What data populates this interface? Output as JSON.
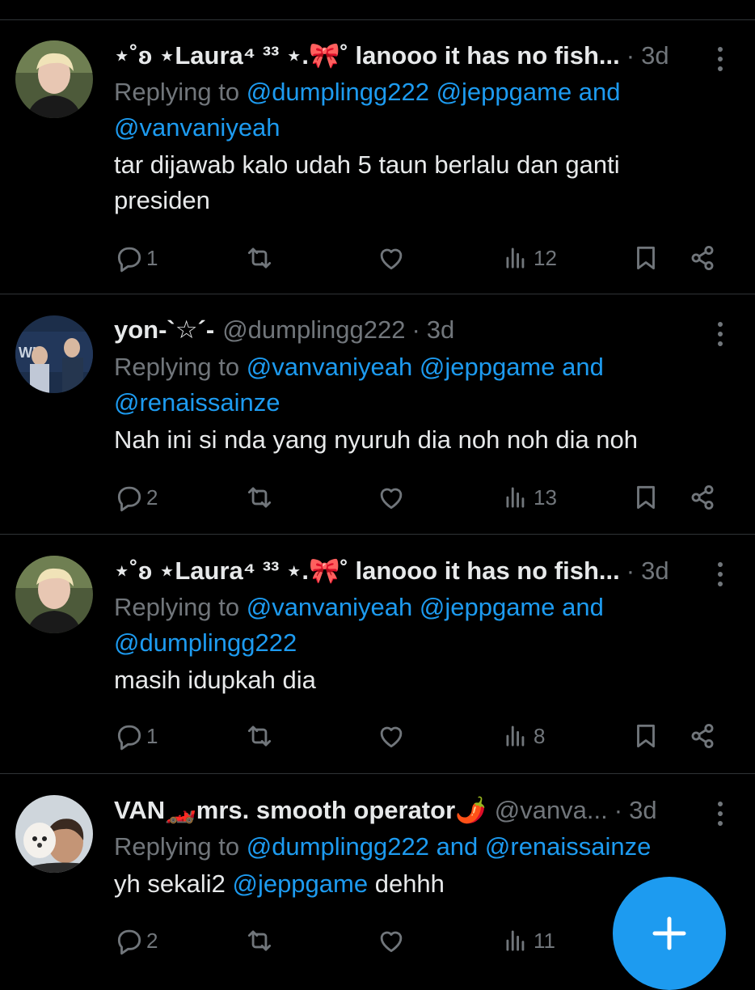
{
  "tweets": [
    {
      "name": "⋆˚ʚ ⋆Laura⁴ ³³ ⋆.🎀˚ lanooo it has no fish...",
      "handle": "",
      "time": "3d",
      "reply_prefix": "Replying to ",
      "reply_line1": "@dumplingg222 @jeppgame and",
      "reply_line2": "@vanvaniyeah",
      "text": "tar dijawab kalo udah 5 taun berlalu dan ganti presiden",
      "replies": "1",
      "views": "12"
    },
    {
      "name": "yon-`☆´-",
      "handle": "@dumplingg222",
      "time": "3d",
      "reply_prefix": "Replying to ",
      "reply_line1": "@vanvaniyeah @jeppgame and",
      "reply_line2": "@renaissainze",
      "text": "Nah ini si nda yang nyuruh dia noh noh dia noh",
      "replies": "2",
      "views": "13"
    },
    {
      "name": "⋆˚ʚ ⋆Laura⁴ ³³ ⋆.🎀˚ lanooo it has no fish...",
      "handle": "",
      "time": "3d",
      "reply_prefix": "Replying to ",
      "reply_line1": "@vanvaniyeah @jeppgame and",
      "reply_line2": "@dumplingg222",
      "text": "masih idupkah dia",
      "replies": "1",
      "views": "8"
    },
    {
      "name": "VAN🏎️mrs. smooth operator🌶️",
      "handle": "@vanva...",
      "time": "3d",
      "reply_prefix": "Replying to ",
      "reply_line1": "@dumplingg222 and @renaissainze",
      "text_before": "yh sekali2 ",
      "text_mention": "@jeppgame",
      "text_after": " dehhh",
      "replies": "2",
      "views": "11"
    }
  ],
  "icons": {
    "reply": "reply-icon",
    "retweet": "retweet-icon",
    "like": "heart-icon",
    "views": "views-icon",
    "bookmark": "bookmark-icon",
    "share": "share-icon",
    "compose": "plus-icon"
  },
  "colors": {
    "background": "#000000",
    "text": "#e7e9ea",
    "muted": "#71767b",
    "accent": "#1d9bf0",
    "divider": "#2f3336"
  }
}
